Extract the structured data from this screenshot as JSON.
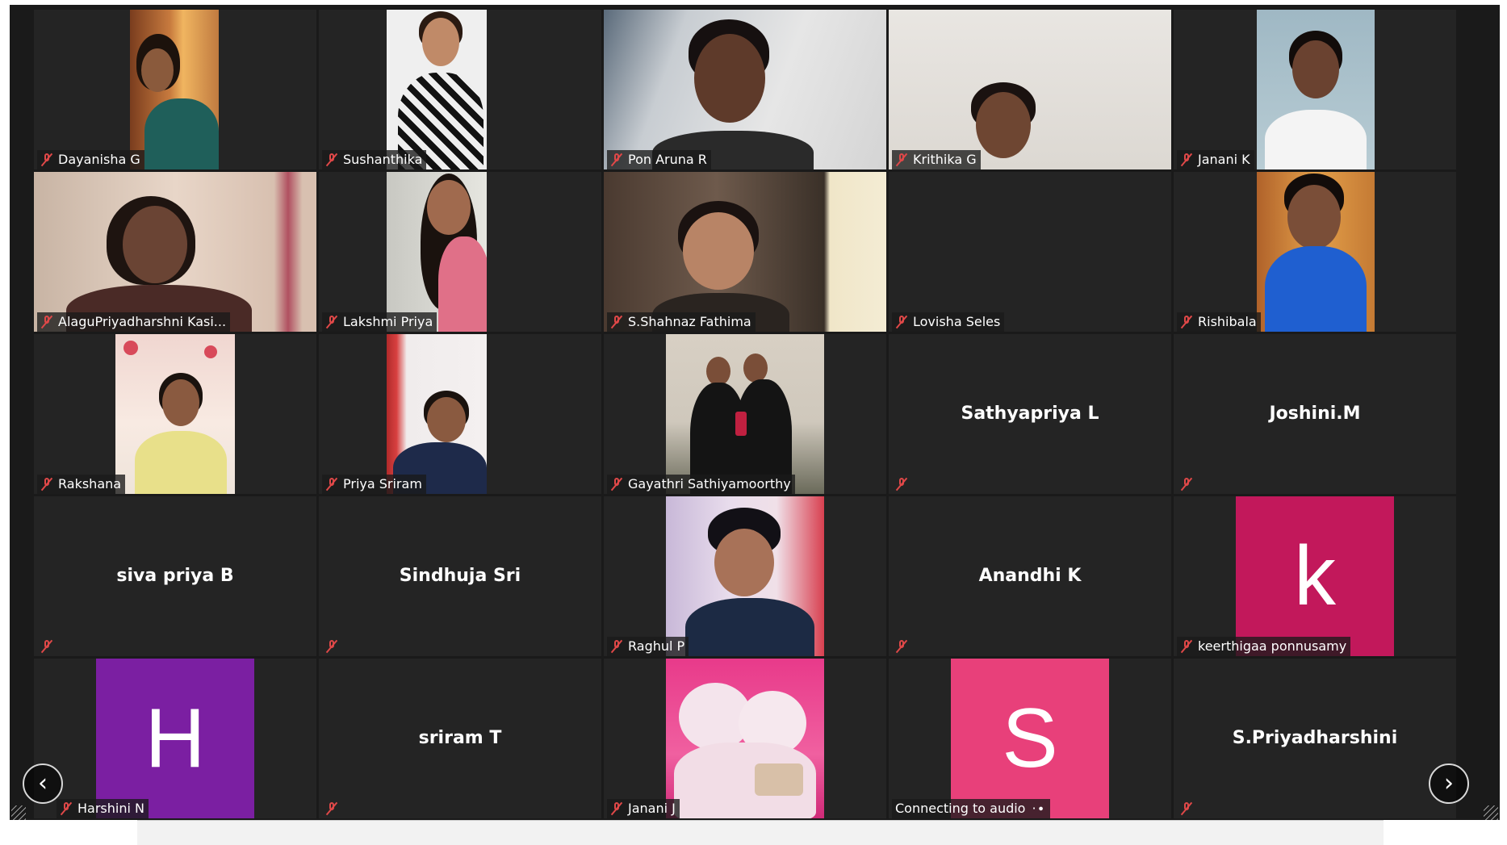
{
  "participants": [
    {
      "name": "Dayanisha G",
      "type": "video",
      "muted": true
    },
    {
      "name": "Sushanthika",
      "type": "video",
      "muted": true
    },
    {
      "name": "Pon Aruna R",
      "type": "video",
      "muted": true
    },
    {
      "name": "Krithika G",
      "type": "video",
      "muted": true
    },
    {
      "name": "Janani K",
      "type": "video",
      "muted": true
    },
    {
      "name": "AlaguPriyadharshni Kasi...",
      "type": "video",
      "muted": true
    },
    {
      "name": "Lakshmi Priya",
      "type": "video",
      "muted": true
    },
    {
      "name": "S.Shahnaz Fathima",
      "type": "video",
      "muted": true
    },
    {
      "name": "Lovisha Seles",
      "type": "video",
      "muted": true
    },
    {
      "name": "Rishibala",
      "type": "video",
      "muted": true
    },
    {
      "name": "Rakshana",
      "type": "video",
      "muted": true
    },
    {
      "name": "Priya Sriram",
      "type": "video",
      "muted": true
    },
    {
      "name": "Gayathri Sathiyamoorthy",
      "type": "video",
      "muted": true
    },
    {
      "name": "Sathyapriya L",
      "type": "name-only",
      "muted": true
    },
    {
      "name": "Joshini.M",
      "type": "name-only",
      "muted": true
    },
    {
      "name": "siva priya B",
      "type": "name-only",
      "muted": true
    },
    {
      "name": "Sindhuja Sri",
      "type": "name-only",
      "muted": true
    },
    {
      "name": "Raghul P",
      "type": "video",
      "muted": true
    },
    {
      "name": "Anandhi K",
      "type": "name-only",
      "muted": true
    },
    {
      "name": "keerthigaa ponnusamy",
      "type": "avatar",
      "initial": "k",
      "avatar_color": "#c2185b",
      "muted": true
    },
    {
      "name": "Harshini N",
      "type": "avatar",
      "initial": "H",
      "avatar_color": "#7b1fa2",
      "muted": true
    },
    {
      "name": "sriram T",
      "type": "name-only",
      "muted": true
    },
    {
      "name": "Janani J",
      "type": "video",
      "muted": true
    },
    {
      "name": "Connecting to audio",
      "type": "avatar",
      "initial": "S",
      "avatar_color": "#e8407a",
      "muted": false,
      "connecting": true
    },
    {
      "name": "S.Priyadharshini",
      "type": "name-only",
      "muted": true
    }
  ],
  "navigation": {
    "prev_icon": "chevron-left-icon",
    "next_icon": "chevron-right-icon",
    "prev_glyph": "‹",
    "next_glyph": "›",
    "connecting_dots": "·∙"
  },
  "colors": {
    "background": "#1a1a1a",
    "tile": "#242424",
    "muted_icon": "#e04848"
  }
}
